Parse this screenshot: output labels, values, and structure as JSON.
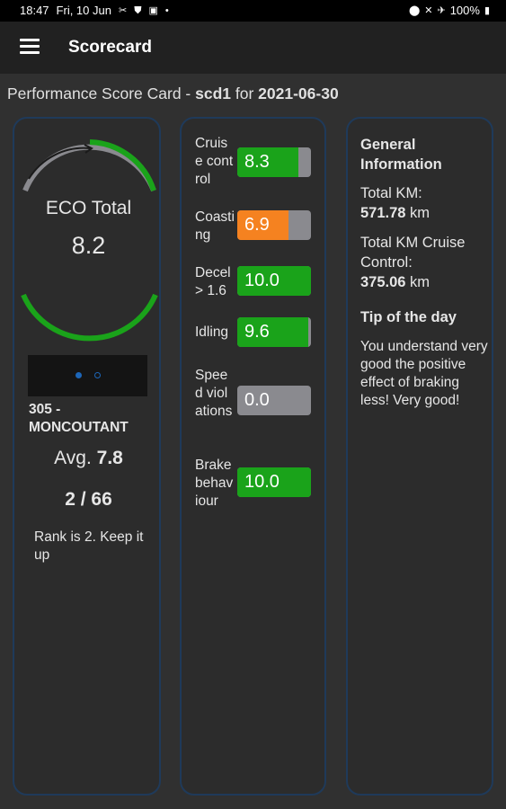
{
  "status_bar": {
    "time": "18:47",
    "date": "Fri, 10 Jun",
    "battery": "100%"
  },
  "app_bar": {
    "title": "Scorecard"
  },
  "header": {
    "prefix": "Performance Score Card - ",
    "vehicle": "scd1",
    "for_text": " for ",
    "date": "2021-06-30"
  },
  "eco": {
    "title": "ECO Total",
    "value": "8.2"
  },
  "carousel": {
    "pages": 2,
    "active_page": 1
  },
  "site": {
    "name": "305 - MONCOUTANT",
    "avg_prefix": "Avg. ",
    "avg_value": "7.8",
    "rank": "2 / 66",
    "rank_message": "Rank is 2. Keep it up"
  },
  "scores": [
    {
      "label": "Cruise control",
      "value": "8.3",
      "level": 0.83,
      "color": "#1aa31a"
    },
    {
      "label": "Coasting",
      "value": "6.9",
      "level": 0.69,
      "color": "#f58220"
    },
    {
      "label": "Decel > 1.6",
      "value": "10.0",
      "level": 1.0,
      "color": "#1aa31a"
    },
    {
      "label": "Idling",
      "value": "9.6",
      "level": 0.96,
      "color": "#1aa31a"
    },
    {
      "label": "Speed violations",
      "value": "0.0",
      "level": 0.0,
      "color": "#1aa31a"
    },
    {
      "label": "Brake behaviour",
      "value": "10.0",
      "level": 1.0,
      "color": "#1aa31a"
    }
  ],
  "info": {
    "title": "General Information",
    "total_km_label": "Total KM:",
    "total_km_value": "571.78",
    "km_unit": " km",
    "cruise_km_label": "Total KM Cruise Control:",
    "cruise_km_value": "375.06",
    "tip_title": "Tip of the day",
    "tip_text": "You understand very good the positive effect of braking less! Very good!"
  },
  "colors": {
    "good": "#1aa31a",
    "warning": "#f58220",
    "empty": "#8a8a8f",
    "panel_border": "#1f3a5a",
    "accent_blue": "#1d66b8"
  }
}
